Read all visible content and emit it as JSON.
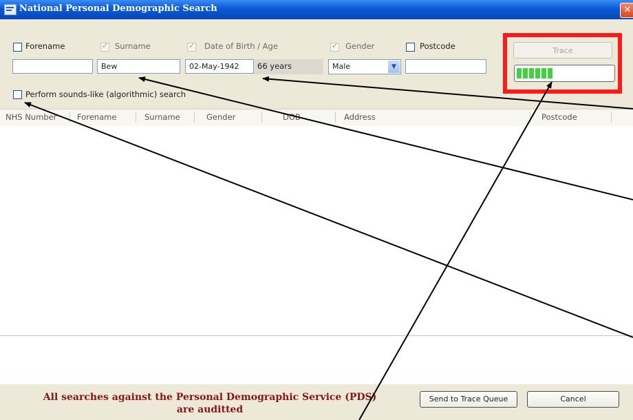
{
  "window": {
    "title": "National Personal Demographic Search",
    "close_glyph": "✕"
  },
  "filters": {
    "forename": {
      "label": "Forename",
      "checked": false,
      "value": ""
    },
    "surname": {
      "label": "Surname",
      "checked": true,
      "value": "Bew"
    },
    "dob": {
      "label": "Date of Birth / Age",
      "checked": true,
      "value": "02-May-1942",
      "age": "66 years"
    },
    "gender": {
      "label": "Gender",
      "checked": true,
      "value": "Male"
    },
    "postcode": {
      "label": "Postcode",
      "checked": false,
      "value": ""
    },
    "soundslike": {
      "label": "Perform sounds-like (algorithmic) search",
      "checked": false
    }
  },
  "trace": {
    "label": "Trace",
    "progress_segments_filled": 6,
    "progress_fraction": 0.42
  },
  "grid": {
    "columns": [
      "NHS Number",
      "Forename",
      "Surname",
      "Gender",
      "DOB",
      "Address",
      "Postcode"
    ]
  },
  "footer": {
    "audit_line1": "All searches against the Personal Demographic Service (PDS)",
    "audit_line2": "are auditted",
    "send_label": "Send to Trace Queue",
    "cancel_label": "Cancel"
  },
  "colors": {
    "highlight": "#ff1a1a",
    "audit_text": "#8b1515",
    "titlebar": "#0a5ad6",
    "progress": "#3ed23e"
  },
  "icons": {
    "window_icon": "app-window-icon",
    "close": "close-icon",
    "dropdown": "chevron-down-icon"
  }
}
